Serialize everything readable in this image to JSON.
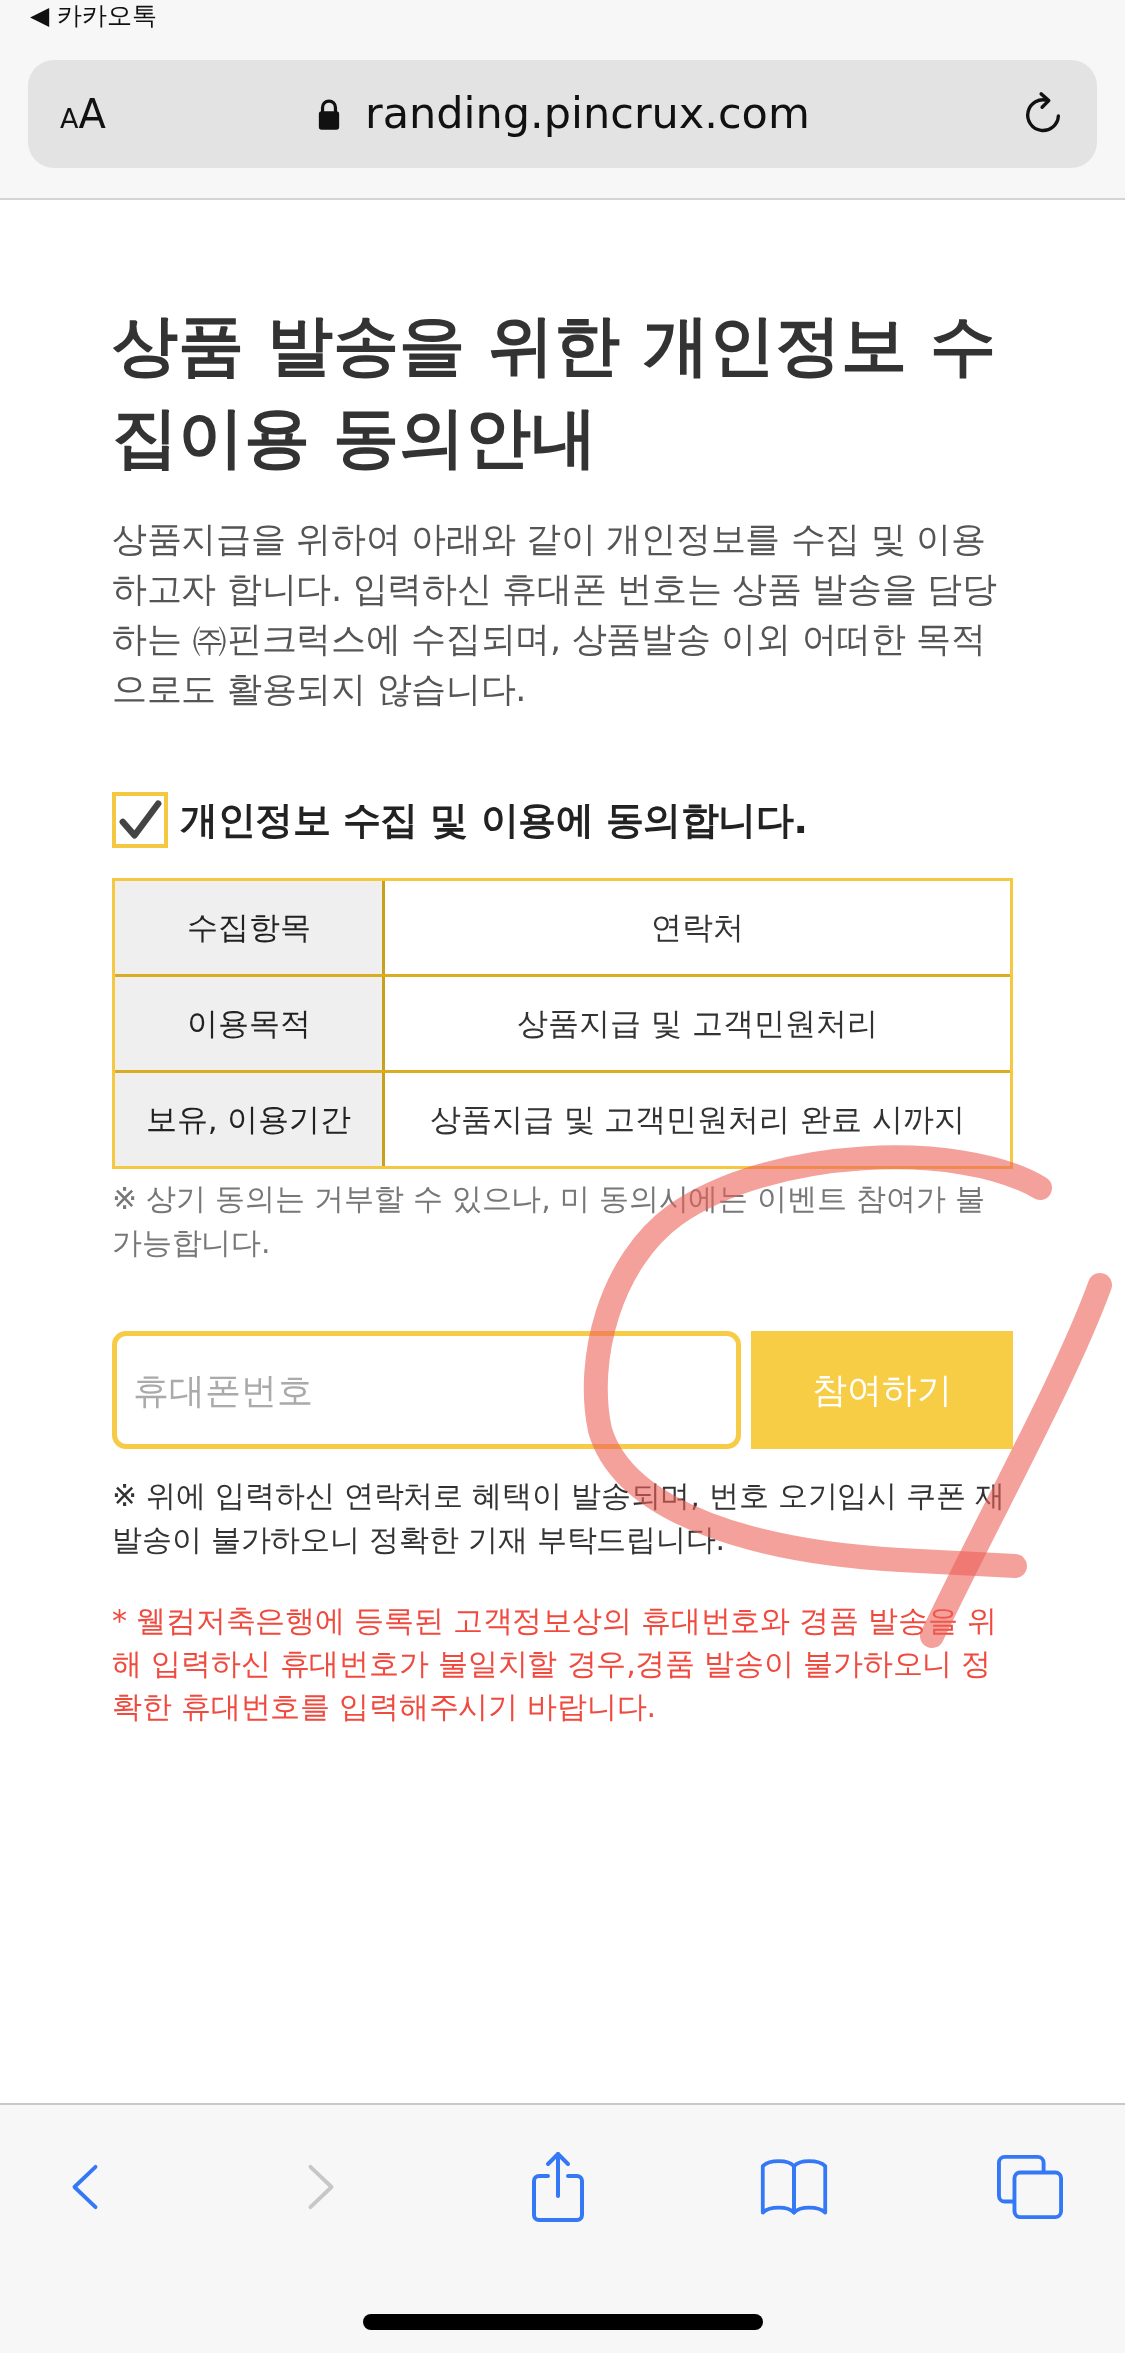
{
  "status_bar": {
    "back_to_app": "◀ 카카오톡"
  },
  "address_bar": {
    "text_size_button": {
      "small": "A",
      "large": "A"
    },
    "secure": true,
    "url": "randing.pincrux.com"
  },
  "page": {
    "title": "상품 발송을 위한 개인정보 수집이용 동의안내",
    "intro": "상품지급을 위하여 아래와 같이 개인정보를 수집 및 이용하고자 합니다. 입력하신 휴대폰 번호는 상품 발송을 담당하는 ㈜핀크럭스에 수집되며, 상품발송 이외 어떠한 목적으로도 활용되지 않습니다.",
    "consent": {
      "checked": true,
      "label": "개인정보 수집 및 이용에 동의합니다."
    },
    "table": {
      "rows": [
        {
          "header": "수집항목",
          "value": "연락처"
        },
        {
          "header": "이용목적",
          "value": "상품지급 및 고객민원처리"
        },
        {
          "header": "보유, 이용기간",
          "value": "상품지급 및 고객민원처리 완료 시까지"
        }
      ]
    },
    "consent_note": "※ 상기 동의는 거부할 수 있으나, 미 동의시에는 이벤트 참여가 불가능합니다.",
    "phone_field": {
      "placeholder": "휴대폰번호"
    },
    "submit_button": "참여하기",
    "notice": "※ 위에 입력하신 연락처로 혜택이 발송되며, 번호 오기입시 쿠폰 재발송이 불가하오니 정확한 기재 부탁드립니다.",
    "warning": "* 웰컴저축은행에 등록된 고객정보상의 휴대번호와 경품 발송을 위해 입력하신 휴대번호가 불일치할 경우,경품 발송이 불가하오니 정확한 휴대번호를 입력해주시기 바랍니다."
  },
  "toolbar": {
    "items": [
      {
        "kind": "back",
        "disabled": false
      },
      {
        "kind": "forward",
        "disabled": true
      },
      {
        "kind": "share",
        "disabled": false
      },
      {
        "kind": "bookmarks",
        "disabled": false
      },
      {
        "kind": "tabs",
        "disabled": false
      }
    ]
  }
}
